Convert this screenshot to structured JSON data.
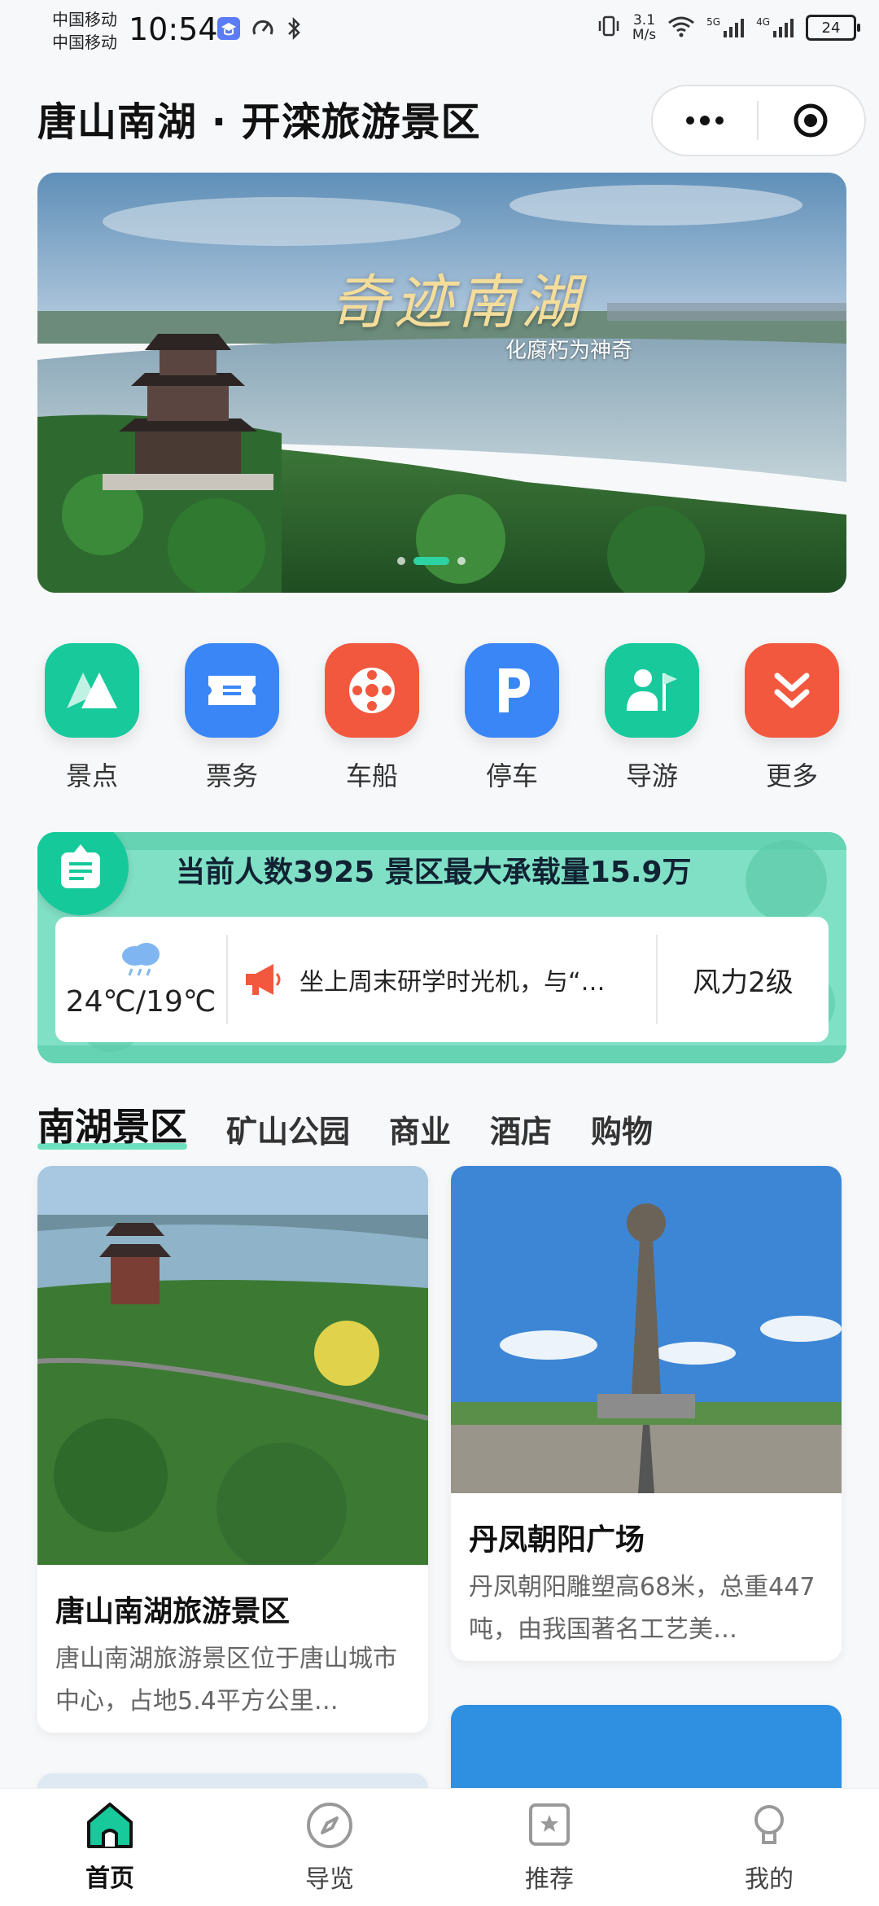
{
  "status": {
    "carrier1": "中国移动",
    "carrier2": "中国移动",
    "time": "10:54",
    "net_speed_value": "3.1",
    "net_speed_unit": "M/s",
    "tech1": "5G",
    "tech2": "4G",
    "battery": "24"
  },
  "header": {
    "title": "唐山南湖 · 开滦旅游景区"
  },
  "banner": {
    "title": "奇迹南湖",
    "subtitle": "化腐朽为神奇",
    "slides": 3,
    "active_slide": 2
  },
  "quick": [
    {
      "label": "景点",
      "icon": "mountain-icon",
      "color": "#18c99b"
    },
    {
      "label": "票务",
      "icon": "ticket-icon",
      "color": "#3b86f6"
    },
    {
      "label": "车船",
      "icon": "wheel-icon",
      "color": "#f2583e"
    },
    {
      "label": "停车",
      "icon": "parking-icon",
      "color": "#3b86f6"
    },
    {
      "label": "导游",
      "icon": "guide-icon",
      "color": "#18c99b"
    },
    {
      "label": "更多",
      "icon": "more-icon",
      "color": "#f2583e"
    }
  ],
  "info": {
    "count_text": "当前人数3925 景区最大承载量15.9万",
    "weather_temp": "24℃/19℃",
    "notice": "坐上周末研学时光机，与“…",
    "wind": "风力2级"
  },
  "tabs": [
    "南湖景区",
    "矿山公园",
    "商业",
    "酒店",
    "购物"
  ],
  "active_tab": 0,
  "cards": [
    {
      "title": "唐山南湖旅游景区",
      "desc": "唐山南湖旅游景区位于唐山城市中心，占地5.4平方公里…"
    },
    {
      "title": "丹凤朝阳广场",
      "desc": "丹凤朝阳雕塑高68米，总重447吨，由我国著名工艺美…"
    }
  ],
  "nav": [
    {
      "label": "首页",
      "icon": "home-icon",
      "active": true
    },
    {
      "label": "导览",
      "icon": "compass-icon",
      "active": false
    },
    {
      "label": "推荐",
      "icon": "recommend-icon",
      "active": false
    },
    {
      "label": "我的",
      "icon": "profile-icon",
      "active": false
    }
  ]
}
